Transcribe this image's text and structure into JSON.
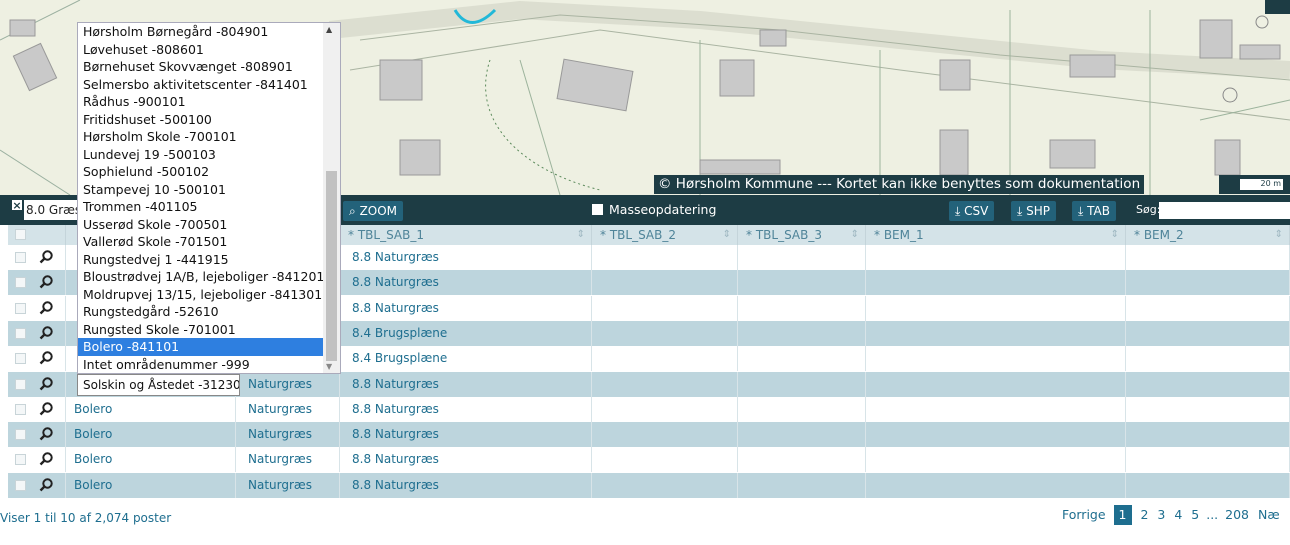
{
  "map": {
    "copyright": "© Hørsholm Kommune --- Kortet kan ikke benyttes som dokumentation",
    "scale_label": "20 m"
  },
  "toolbar": {
    "filter_value": "8.0 Græs",
    "zoom_label": "ZOOM",
    "masse_label": "Masseopdatering",
    "csv_label": "CSV",
    "shp_label": "SHP",
    "tab_label": "TAB",
    "search_label": "Søg:"
  },
  "columns": [
    "* TBL_SAB_1",
    "* TBL_SAB_2",
    "* TBL_SAB_3",
    "* BEM_1",
    "* BEM_2"
  ],
  "rows": [
    {
      "area": "",
      "type": "",
      "tbl_sab_1": "8.8 Naturgræs"
    },
    {
      "area": "",
      "type": "",
      "tbl_sab_1": "8.8 Naturgræs"
    },
    {
      "area": "",
      "type": "",
      "tbl_sab_1": "8.8 Naturgræs"
    },
    {
      "area": "",
      "type": "",
      "tbl_sab_1": "8.4 Brugsplæne"
    },
    {
      "area": "",
      "type": "",
      "tbl_sab_1": "8.4 Brugsplæne"
    },
    {
      "area": "",
      "type": "Naturgræs",
      "tbl_sab_1": "8.8 Naturgræs"
    },
    {
      "area": "Bolero",
      "type": "Naturgræs",
      "tbl_sab_1": "8.8 Naturgræs"
    },
    {
      "area": "Bolero",
      "type": "Naturgræs",
      "tbl_sab_1": "8.8 Naturgræs"
    },
    {
      "area": "Bolero",
      "type": "Naturgræs",
      "tbl_sab_1": "8.8 Naturgræs"
    },
    {
      "area": "Bolero",
      "type": "Naturgræs",
      "tbl_sab_1": "8.8 Naturgræs"
    }
  ],
  "dropdown": {
    "items": [
      "Hørsholm Børnegård -804901",
      "Løvehuset -808601",
      "Børnehuset Skovvænget -808901",
      "Selmersbo aktivitetscenter -841401",
      "Rådhus -900101",
      "Fritidshuset -500100",
      "Hørsholm Skole -700101",
      "Lundevej 19 -500103",
      "Sophielund -500102",
      "Stampevej 10 -500101",
      "Trommen -401105",
      "Usserød Skole -700501",
      "Vallerød Skole -701501",
      "Rungstedvej 1 -441915",
      "Bloustrødvej 1A/B, lejeboliger -841201",
      "Moldrupvej 13/15, lejeboliger -841301",
      "Rungstedgård -52610",
      "Rungsted Skole -701001",
      "Bolero -841101",
      "Intet områdenummer -999"
    ],
    "selected_index": 18,
    "typed_value": "Solskin og Åstedet -31230"
  },
  "footer": {
    "summary": "Viser 1 til 10 af 2,074 poster",
    "prev": "Forrige",
    "pages": [
      "1",
      "2",
      "3",
      "4",
      "5",
      "...",
      "208"
    ],
    "next": "Næ"
  }
}
